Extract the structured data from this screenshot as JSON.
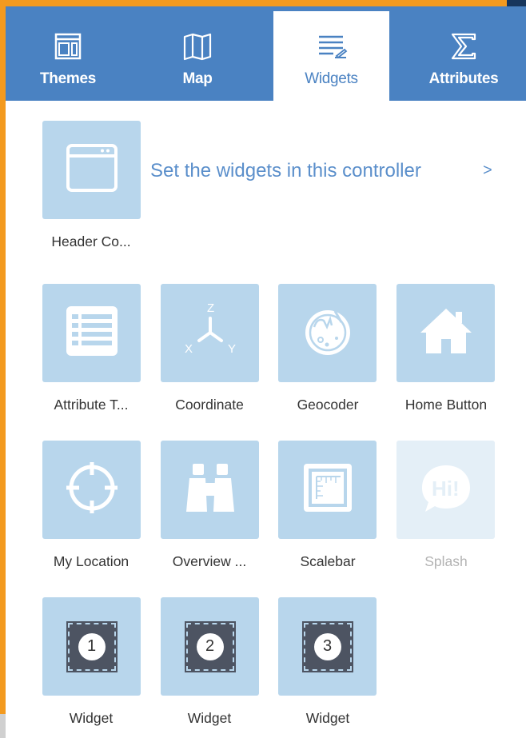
{
  "tabs": [
    {
      "label": "Themes",
      "icon": "themes-icon"
    },
    {
      "label": "Map",
      "icon": "map-icon"
    },
    {
      "label": "Widgets",
      "icon": "widgets-icon",
      "active": true
    },
    {
      "label": "Attributes",
      "icon": "sigma-icon"
    }
  ],
  "header_controller": {
    "label": "Header Co...",
    "link_text": "Set the widgets in this controller",
    "arrow": ">"
  },
  "widgets": [
    {
      "label": "Attribute T...",
      "icon": "attribute-table-icon"
    },
    {
      "label": "Coordinate",
      "icon": "coordinate-icon"
    },
    {
      "label": "Geocoder",
      "icon": "geocoder-icon"
    },
    {
      "label": "Home Button",
      "icon": "home-icon"
    },
    {
      "label": "My Location",
      "icon": "my-location-icon"
    },
    {
      "label": "Overview ...",
      "icon": "binoculars-icon"
    },
    {
      "label": "Scalebar",
      "icon": "scalebar-icon"
    },
    {
      "label": "Splash",
      "icon": "splash-icon",
      "disabled": true
    },
    {
      "label": "Widget",
      "icon": "placeholder-widget-icon",
      "number": "1"
    },
    {
      "label": "Widget",
      "icon": "placeholder-widget-icon",
      "number": "2"
    },
    {
      "label": "Widget",
      "icon": "placeholder-widget-icon",
      "number": "3"
    }
  ],
  "colors": {
    "tab_bar": "#4a82c2",
    "tile": "#b8d6ec",
    "tile_disabled": "#e4eff7",
    "frame_accent": "#f39a1f",
    "link": "#5b8fcb"
  }
}
